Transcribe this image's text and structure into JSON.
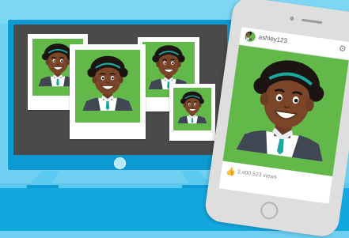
{
  "scene": {
    "colors": {
      "wall": "#6fd0f2",
      "floor": "#12a8df",
      "monitor": "#0d9ad3",
      "screen": "#4a4a4a",
      "photo_background": "#62b94a"
    }
  },
  "phone": {
    "username": "ashley123",
    "views_label": "3,400,523 views",
    "like_icon": "thumbs-up-icon",
    "settings_icon": "gear-icon"
  }
}
